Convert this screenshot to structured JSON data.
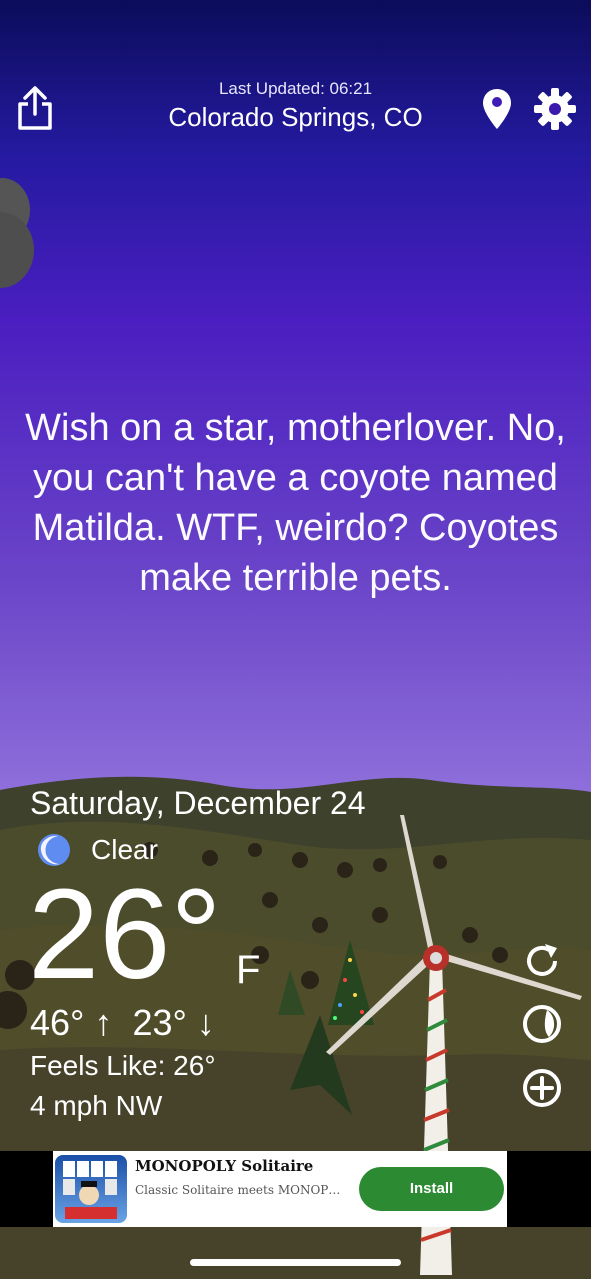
{
  "header": {
    "last_updated": "Last Updated: 06:21",
    "city": "Colorado Springs, CO",
    "share_icon": "share-icon",
    "location_icon": "location-pin-icon",
    "settings_icon": "gear-icon"
  },
  "quote": "Wish on a star, motherlover. No, you can't have a coyote named Matilda. WTF, weirdo? Coyotes make terrible pets.",
  "weather": {
    "day": "Saturday, December 24",
    "condition": "Clear",
    "condition_icon": "moon-icon",
    "temperature": "26°",
    "unit": "F",
    "high": "46° ↑",
    "low": "23° ↓",
    "feels_like": "Feels Like: 26°",
    "wind": "4 mph NW"
  },
  "side_buttons": {
    "refresh_icon": "refresh-icon",
    "radar_icon": "moon-phase-icon",
    "add_icon": "plus-circle-icon"
  },
  "ad": {
    "title": "MONOPOLY Solitaire",
    "subtitle": "Classic Solitaire meets MONOPOLY",
    "button": "Install",
    "logo_text": "MONOPOLY Solitaire"
  },
  "colors": {
    "sky_top": "#0b0c5a",
    "sky_bottom": "#c4aaf2",
    "install_green": "#2c8a33"
  }
}
